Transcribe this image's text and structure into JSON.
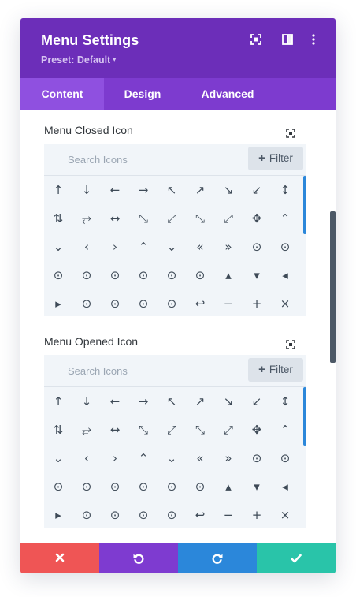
{
  "header": {
    "title": "Menu Settings",
    "preset": "Preset: Default",
    "caret": "▾",
    "icons": [
      "fullscreen-icon",
      "sidebar-toggle-icon",
      "more-options-icon"
    ]
  },
  "tabs": [
    {
      "label": "Content",
      "active": true
    },
    {
      "label": "Design",
      "active": false
    },
    {
      "label": "Advanced",
      "active": false
    }
  ],
  "sections": [
    {
      "label": "Menu Closed Icon",
      "search_placeholder": "Search Icons",
      "filter_label": "Filter",
      "icons": [
        "↑",
        "↓",
        "←",
        "→",
        "↖",
        "↗",
        "↘",
        "↙",
        "↕",
        "⇅",
        "⥂",
        "↔",
        "⤡",
        "⤢",
        "⤡",
        "⤢",
        "✥",
        "⌃",
        "⌄",
        "‹",
        "›",
        "⌃",
        "⌄",
        "«",
        "»",
        "⊙",
        "⊙",
        "⊙",
        "⊙",
        "⊙",
        "⊙",
        "⊙",
        "⊙",
        "▴",
        "▾",
        "◂",
        "▸",
        "⊙",
        "⊙",
        "⊙",
        "⊙",
        "↩",
        "−",
        "+",
        "×"
      ]
    },
    {
      "label": "Menu Opened Icon",
      "search_placeholder": "Search Icons",
      "filter_label": "Filter",
      "icons": [
        "↑",
        "↓",
        "←",
        "→",
        "↖",
        "↗",
        "↘",
        "↙",
        "↕",
        "⇅",
        "⥂",
        "↔",
        "⤡",
        "⤢",
        "⤡",
        "⤢",
        "✥",
        "⌃",
        "⌄",
        "‹",
        "›",
        "⌃",
        "⌄",
        "«",
        "»",
        "⊙",
        "⊙",
        "⊙",
        "⊙",
        "⊙",
        "⊙",
        "⊙",
        "⊙",
        "▴",
        "▾",
        "◂",
        "▸",
        "⊙",
        "⊙",
        "⊙",
        "⊙",
        "↩",
        "−",
        "+",
        "×"
      ]
    }
  ],
  "footer": {
    "buttons": [
      {
        "name": "discard-button",
        "icon": "close-icon",
        "color": "#ef5555"
      },
      {
        "name": "undo-button",
        "icon": "undo-icon",
        "color": "#7e3bd0"
      },
      {
        "name": "redo-button",
        "icon": "redo-icon",
        "color": "#2b87da"
      },
      {
        "name": "save-button",
        "icon": "check-icon",
        "color": "#29c4a9"
      }
    ]
  },
  "colors": {
    "header": "#6c2eb9",
    "tabs": "#7d3bcf",
    "active_tab": "#8f50e0",
    "accent_blue": "#2b87da"
  }
}
